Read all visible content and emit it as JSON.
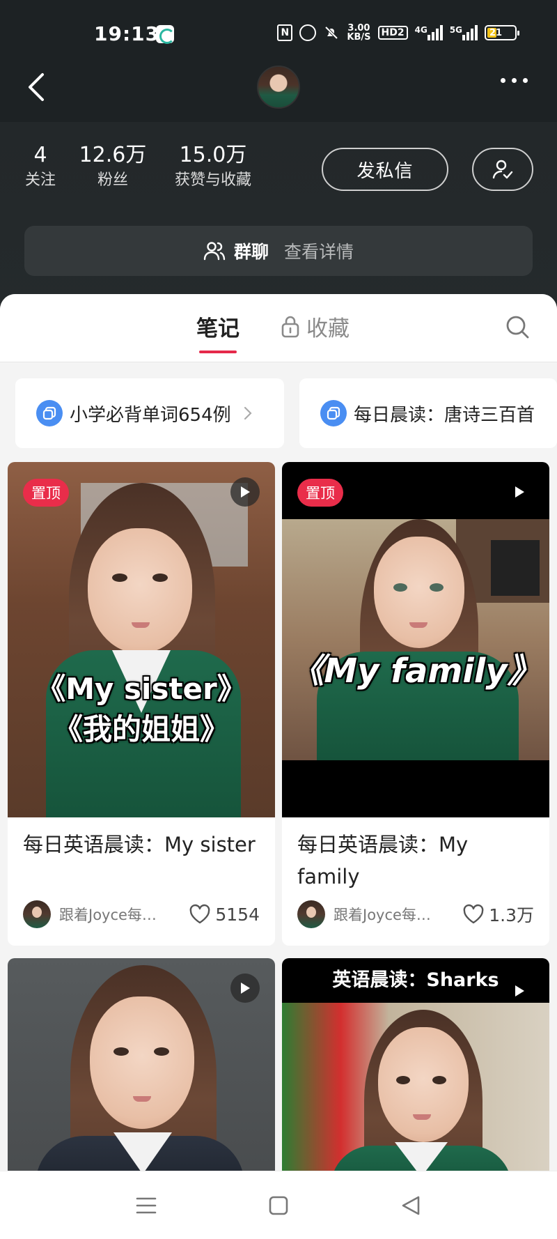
{
  "status_bar": {
    "time": "19:13",
    "speed": "3.00\nKB/S",
    "network_hd": "HD2",
    "network_4g": "4G",
    "network_5g": "5G",
    "battery": "21"
  },
  "profile": {
    "stats": [
      {
        "value": "4",
        "label": "关注"
      },
      {
        "value": "12.6万",
        "label": "粉丝"
      },
      {
        "value": "15.0万",
        "label": "获赞与收藏"
      }
    ],
    "message_button": "发私信",
    "group_chat": {
      "label": "群聊",
      "detail": "查看详情"
    }
  },
  "tabs": {
    "notes": "笔记",
    "collect": "收藏"
  },
  "collections": [
    {
      "title": "小学必背单词654例"
    },
    {
      "title": "每日晨读：唐诗三百首"
    }
  ],
  "posts": [
    {
      "pinned_label": "置顶",
      "cover_text_1": "《My sister》",
      "cover_text_2": "《我的姐姐》",
      "title": "每日英语晨读：My sister",
      "author": "跟着Joyce每…",
      "likes": "5154"
    },
    {
      "pinned_label": "置顶",
      "cover_text_1": "《My family》",
      "title": "每日英语晨读：My family",
      "author": "跟着Joyce每…",
      "likes": "1.3万"
    },
    {
      "cover_text_1": ""
    },
    {
      "cover_text_1": "英语晨读：Sharks"
    }
  ],
  "colors": {
    "accent": "#e5294a",
    "header_bg": "#1d2224",
    "collection_icon": "#4a8ef2"
  }
}
